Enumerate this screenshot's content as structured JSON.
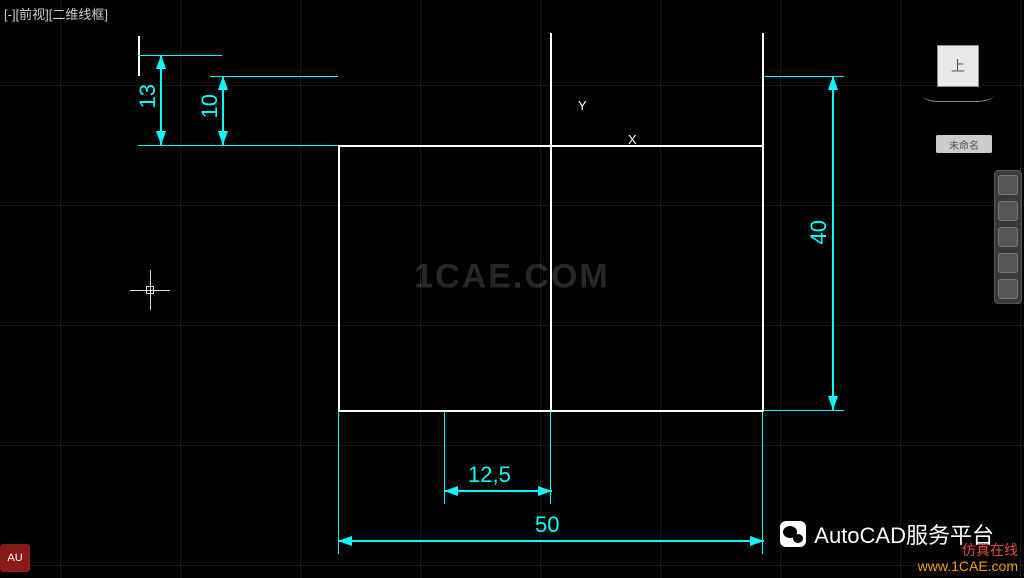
{
  "view_label": "[-][前视][二维线框]",
  "ucs": {
    "x": "X",
    "y": "Y"
  },
  "dimensions": {
    "d13": "13",
    "d10": "10",
    "d40": "40",
    "d12_5": "12,5",
    "d50": "50"
  },
  "viewcube": {
    "face": "上"
  },
  "layer_label": "未命名",
  "watermark_center": "1CAE.COM",
  "watermark_platform": "AutoCAD服务平台",
  "watermark_corner_l1": "仿真在线",
  "watermark_corner_l2": "www.1CAE.com",
  "watermark_au": "AU",
  "colors": {
    "dim": "#00ffff",
    "bg": "#000000",
    "line": "#ffffff"
  }
}
